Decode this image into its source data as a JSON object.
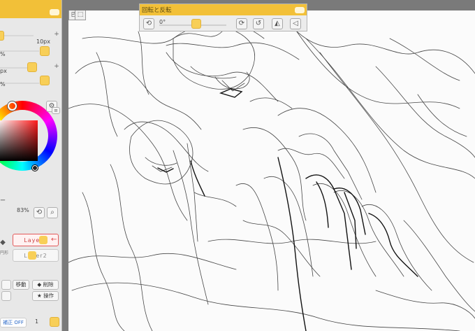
{
  "brush_panel": {
    "size_value": "10px",
    "row2_value": "%",
    "row3_value": "px",
    "row4_value": "%"
  },
  "color_panel": {
    "zoom_label": "ー",
    "zoom_value": "83%"
  },
  "layers_panel": {
    "layer1_name": "Layer1",
    "layer2_name": "Layer2",
    "side_label": "円形"
  },
  "layer_buttons": {
    "move_label": "移動",
    "delete_label": "削除",
    "operate_label": "操作"
  },
  "footer": {
    "stabilizer_label": "補正 OFF",
    "stabilizer_value": "1"
  },
  "rotate_window": {
    "title": "回転と反転",
    "angle_value": "0°"
  },
  "colors": {
    "accent_yellow": "#f2c038",
    "knob_yellow": "#f8cf58",
    "selected_layer_red": "#e35b5b"
  }
}
